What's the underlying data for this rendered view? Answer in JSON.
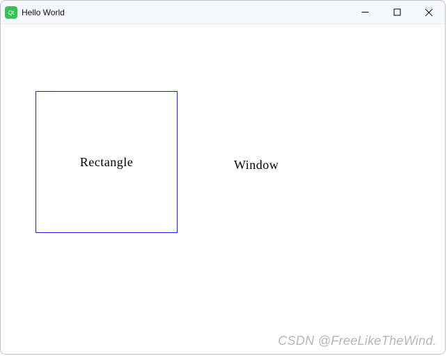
{
  "titlebar": {
    "title": "Hello World"
  },
  "content": {
    "rectangle_label": "Rectangle",
    "window_label": "Window"
  },
  "watermark": "CSDN @FreeLikeTheWind.",
  "colors": {
    "rectangle_border": "#1a1fff",
    "titlebar_bg": "#f5f7fb"
  }
}
